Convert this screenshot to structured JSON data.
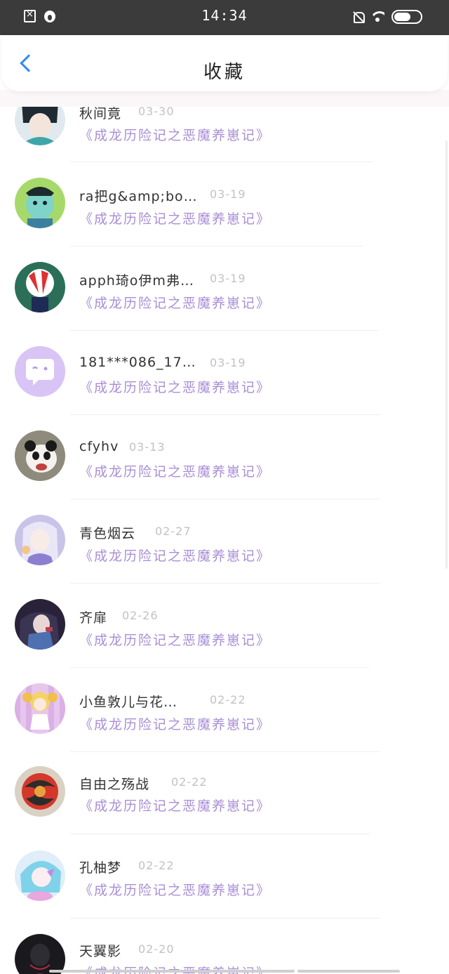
{
  "status_bar": {
    "time": "14:34",
    "icons": [
      "sim-error-icon",
      "flame-icon",
      "bell-off-icon",
      "wifi-icon",
      "battery-icon"
    ],
    "battery_level": 0.65,
    "battery_label": "65"
  },
  "header": {
    "title": "收藏",
    "back_icon": "chevron-left-icon",
    "accent_color": "#2e8bf0"
  },
  "list": {
    "book_color": "#a98ed6",
    "items": [
      {
        "name": "秋间竟",
        "date": "03-30",
        "book": "《成龙历险记之恶魔养崽记》",
        "avatar_icon": "avatar-anime-boy"
      },
      {
        "name": "ra把g&amp;bo…",
        "date": "03-19",
        "book": "《成龙历险记之恶魔养崽记》",
        "avatar_icon": "avatar-green-cartoon"
      },
      {
        "name": "apph琦o伊m弗…",
        "date": "03-19",
        "book": "《成龙历险记之恶魔养崽记》",
        "avatar_icon": "avatar-peppermint-butler"
      },
      {
        "name": "181***086_17…",
        "date": "03-19",
        "book": "《成龙历险记之恶魔养崽记》",
        "avatar_icon": "avatar-default-chat"
      },
      {
        "name": "cfyhv",
        "date": "03-13",
        "book": "《成龙历险记之恶魔养崽记》",
        "avatar_icon": "avatar-panda"
      },
      {
        "name": "青色烟云",
        "date": "02-27",
        "book": "《成龙历险记之恶魔养崽记》",
        "avatar_icon": "avatar-anime-girl"
      },
      {
        "name": "齐扉",
        "date": "02-26",
        "book": "《成龙历险记之恶魔养崽记》",
        "avatar_icon": "avatar-dark-anime"
      },
      {
        "name": "小鱼敦儿与花…",
        "date": "02-22",
        "book": "《成龙历险记之恶魔养崽记》",
        "avatar_icon": "avatar-sheep-girl"
      },
      {
        "name": "自由之殇战",
        "date": "02-22",
        "book": "《成龙历险记之恶魔养崽记》",
        "avatar_icon": "avatar-dragon-art"
      },
      {
        "name": "孔柚梦",
        "date": "02-22",
        "book": "《成龙历险记之恶魔养崽记》",
        "avatar_icon": "avatar-blue-hair"
      },
      {
        "name": "天翼影",
        "date": "02-20",
        "book": "《成龙历险记之恶魔养崽记》",
        "avatar_icon": "avatar-dark-figure"
      }
    ]
  }
}
